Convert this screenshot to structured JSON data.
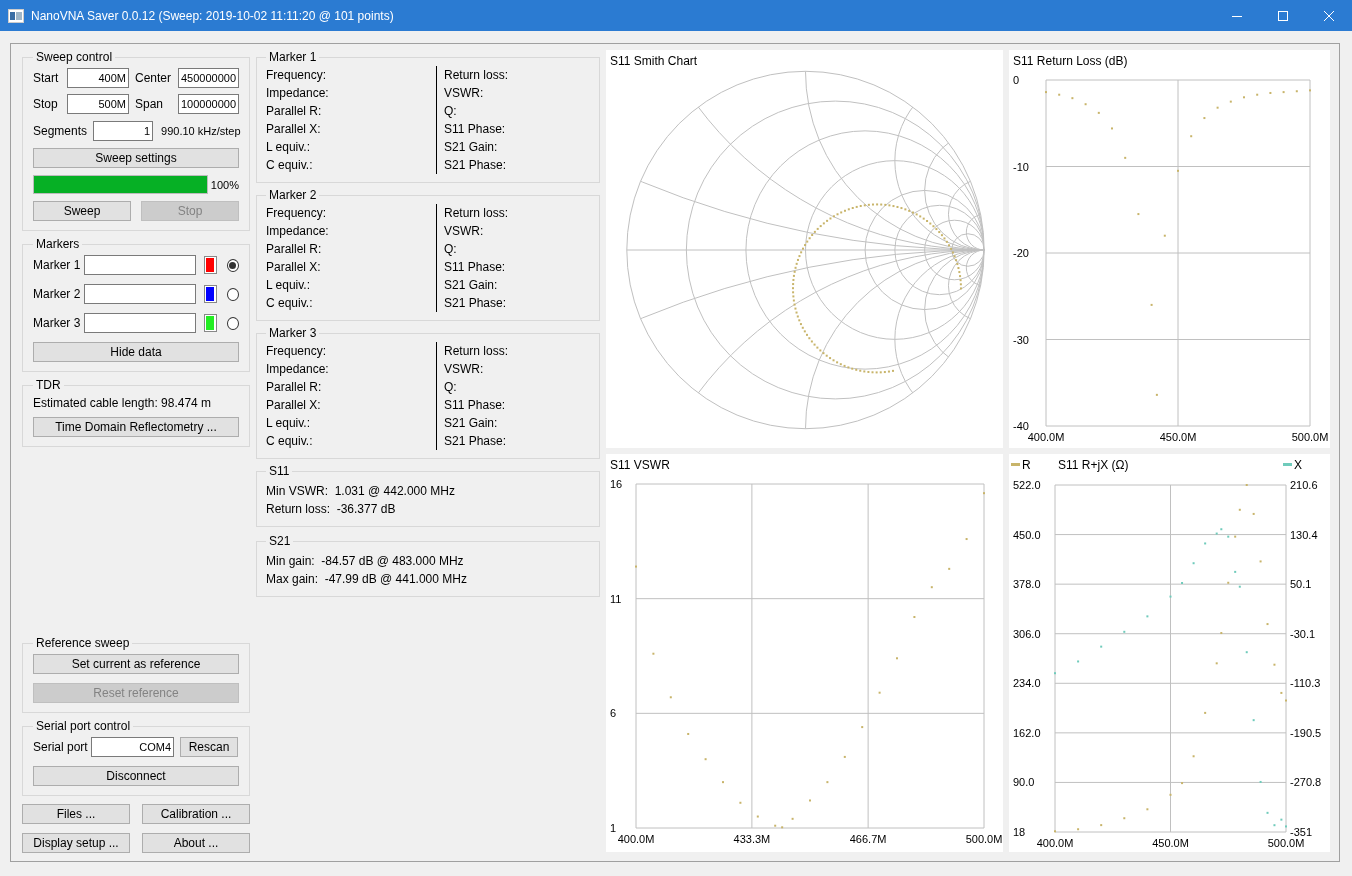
{
  "window": {
    "title": "NanoVNA Saver 0.0.12 (Sweep: 2019-10-02 11:11:20 @ 101 points)"
  },
  "sweep_control": {
    "title": "Sweep control",
    "fields": [
      {
        "label": "Start",
        "value": "400M"
      },
      {
        "label": "Stop",
        "value": "500M"
      },
      {
        "label": "Center",
        "value": "450000000"
      },
      {
        "label": "Span",
        "value": "100000000"
      }
    ],
    "segments": {
      "label": "Segments",
      "value": "1",
      "step": "990.10 kHz/step"
    },
    "settings_button": {
      "label": "Sweep settings",
      "disabled": false
    },
    "progress": {
      "level": 1,
      "reading": "100%"
    },
    "buttons": [
      {
        "label": "Sweep",
        "disabled": false
      },
      {
        "label": "Stop",
        "disabled": true
      }
    ]
  },
  "markers": {
    "title": "Markers",
    "items": [
      {
        "label": "Marker 1",
        "color": "#ff0000",
        "selected": true
      },
      {
        "label": "Marker 2",
        "color": "#0000ff",
        "selected": false
      },
      {
        "label": "Marker 3",
        "color": "#22ee22",
        "selected": false
      }
    ],
    "button": {
      "label": "Hide data",
      "disabled": false
    }
  },
  "tdr": {
    "title": "TDR",
    "text": "Estimated cable length: 98.474 m",
    "button": {
      "label": "Time Domain Reflectometry ...",
      "disabled": false
    }
  },
  "reference_sweep": {
    "title": "Reference sweep",
    "buttons": [
      {
        "label": "Set current as reference",
        "disabled": false
      },
      {
        "label": "Reset reference",
        "disabled": true
      }
    ]
  },
  "serial_port": {
    "title": "Serial port control",
    "label": "Serial port",
    "value": "COM4",
    "rescan": {
      "label": "Rescan",
      "disabled": false
    },
    "disconnect": {
      "label": "Disconnect",
      "disabled": false
    }
  },
  "bottom_buttons": [
    {
      "label": "Files ...",
      "disabled": false
    },
    {
      "label": "Calibration ...",
      "disabled": false
    },
    {
      "label": "Display setup ...",
      "disabled": false
    },
    {
      "label": "About ...",
      "disabled": false
    }
  ],
  "marker_panels": [
    {
      "title": "Marker 1",
      "left": [
        "Frequency:",
        "Impedance:",
        "Parallel R:",
        "Parallel X:",
        "L equiv.:",
        "C equiv.:"
      ],
      "right": [
        "Return loss:",
        "VSWR:",
        "Q:",
        "S11 Phase:",
        "S21 Gain:",
        "S21 Phase:"
      ]
    },
    {
      "title": "Marker 2",
      "left": [
        "Frequency:",
        "Impedance:",
        "Parallel R:",
        "Parallel X:",
        "L equiv.:",
        "C equiv.:"
      ],
      "right": [
        "Return loss:",
        "VSWR:",
        "Q:",
        "S11 Phase:",
        "S21 Gain:",
        "S21 Phase:"
      ]
    },
    {
      "title": "Marker 3",
      "left": [
        "Frequency:",
        "Impedance:",
        "Parallel R:",
        "Parallel X:",
        "L equiv.:",
        "C equiv.:"
      ],
      "right": [
        "Return loss:",
        "VSWR:",
        "Q:",
        "S11 Phase:",
        "S21 Gain:",
        "S21 Phase:"
      ]
    }
  ],
  "summaries": [
    {
      "title": "S11",
      "lines": [
        "Min VSWR:  1.031 @ 442.000 MHz",
        "Return loss:  -36.377 dB"
      ]
    },
    {
      "title": "S21",
      "lines": [
        "Min gain:  -84.57 dB @ 483.000 MHz",
        "Max gain:  -47.99 dB @ 441.000 MHz"
      ]
    }
  ],
  "smith_chart": {
    "title": "S11 Smith Chart"
  },
  "return_loss_chart": {
    "chart_data": {
      "type": "scatter",
      "title": "S11 Return Loss (dB)",
      "grid": true,
      "x": [
        400,
        405,
        410,
        415,
        420,
        425,
        430,
        435,
        440,
        442,
        445,
        450,
        455,
        460,
        465,
        470,
        475,
        480,
        485,
        490,
        495,
        500
      ],
      "xlim": [
        400,
        500
      ],
      "ylim": [
        -40,
        0
      ],
      "xticks": [
        {
          "value": 400,
          "label": "400.0M"
        },
        {
          "value": 450,
          "label": "450.0M"
        },
        {
          "value": 500,
          "label": "500.0M"
        }
      ],
      "yticks": [
        0,
        -10,
        -20,
        -30,
        -40
      ],
      "series": [
        {
          "color": "#c8b46a",
          "values": [
            -1.4,
            -1.7,
            -2.1,
            -2.8,
            -3.8,
            -5.6,
            -9.0,
            -15.5,
            -26,
            -36.4,
            -18,
            -10.5,
            -6.5,
            -4.4,
            -3.2,
            -2.5,
            -2.0,
            -1.7,
            -1.5,
            -1.4,
            -1.3,
            -1.2
          ]
        }
      ]
    }
  },
  "vswr_chart": {
    "chart_data": {
      "type": "scatter",
      "title": "S11 VSWR",
      "grid": true,
      "x": [
        400,
        405,
        410,
        415,
        420,
        425,
        430,
        435,
        440,
        442,
        445,
        450,
        455,
        460,
        465,
        470,
        475,
        480,
        485,
        490,
        495,
        500
      ],
      "xlim": [
        400,
        500
      ],
      "ylim": [
        1,
        16
      ],
      "xticks": [
        {
          "value": 400,
          "label": "400.0M"
        },
        {
          "value": 433.3,
          "label": "433.3M"
        },
        {
          "value": 466.7,
          "label": "466.7M"
        },
        {
          "value": 500,
          "label": "500.0M"
        }
      ],
      "yticks": [
        16,
        11,
        6,
        1
      ],
      "series": [
        {
          "color": "#c8b46a",
          "values": [
            12.4,
            8.6,
            6.7,
            5.1,
            4.0,
            3.0,
            2.1,
            1.5,
            1.1,
            1.03,
            1.4,
            2.2,
            3.0,
            4.1,
            5.4,
            6.9,
            8.4,
            10.2,
            11.5,
            12.3,
            13.6,
            15.6
          ]
        }
      ]
    }
  },
  "rjx_chart": {
    "chart_data": {
      "type": "scatter",
      "title": "S11 R+jX (Ω)",
      "grid": true,
      "legend": "top",
      "x": [
        400,
        410,
        420,
        430,
        440,
        450,
        455,
        460,
        465,
        470,
        472,
        475,
        478,
        480,
        483,
        486,
        489,
        492,
        495,
        498,
        500
      ],
      "xlim": [
        400,
        500
      ],
      "ylim": [
        18,
        522
      ],
      "y2lim": [
        -351,
        210.6
      ],
      "xticks": [
        {
          "value": 400,
          "label": "400.0M"
        },
        {
          "value": 450,
          "label": "450.0M"
        },
        {
          "value": 500,
          "label": "500.0M"
        }
      ],
      "yticks": [
        {
          "value": 522,
          "label": "522.0"
        },
        {
          "value": 450,
          "label": "450.0"
        },
        {
          "value": 378,
          "label": "378.0"
        },
        {
          "value": 306,
          "label": "306.0"
        },
        {
          "value": 234,
          "label": "234.0"
        },
        {
          "value": 162,
          "label": "162.0"
        },
        {
          "value": 90,
          "label": "90.0"
        },
        {
          "value": 18,
          "label": "18"
        }
      ],
      "y2ticks": [
        {
          "value": 210.6,
          "label": "210.6"
        },
        {
          "value": 130.4,
          "label": "130.4"
        },
        {
          "value": 50.1,
          "label": "50.1"
        },
        {
          "value": -30.1,
          "label": "-30.1"
        },
        {
          "value": -110.3,
          "label": "-110.3"
        },
        {
          "value": -190.5,
          "label": "-190.5"
        },
        {
          "value": -270.8,
          "label": "-270.8"
        },
        {
          "value": -351,
          "label": "-351"
        }
      ],
      "series": [
        {
          "name": "R",
          "color": "#c8b46a",
          "values": [
            19,
            22,
            28,
            38,
            51,
            72,
            89,
            128,
            191,
            263,
            307,
            380,
            447,
            486,
            522,
            480,
            411,
            320,
            261,
            220,
            209
          ]
        },
        {
          "name": "X",
          "color": "#6fcbbb",
          "axis": "y2",
          "values": [
            -94,
            -75,
            -51,
            -27,
            -2,
            30,
            52,
            84,
            116,
            132,
            139,
            127,
            70,
            46,
            -60,
            -170,
            -270,
            -320,
            -340,
            -331,
            -342
          ]
        }
      ]
    }
  }
}
